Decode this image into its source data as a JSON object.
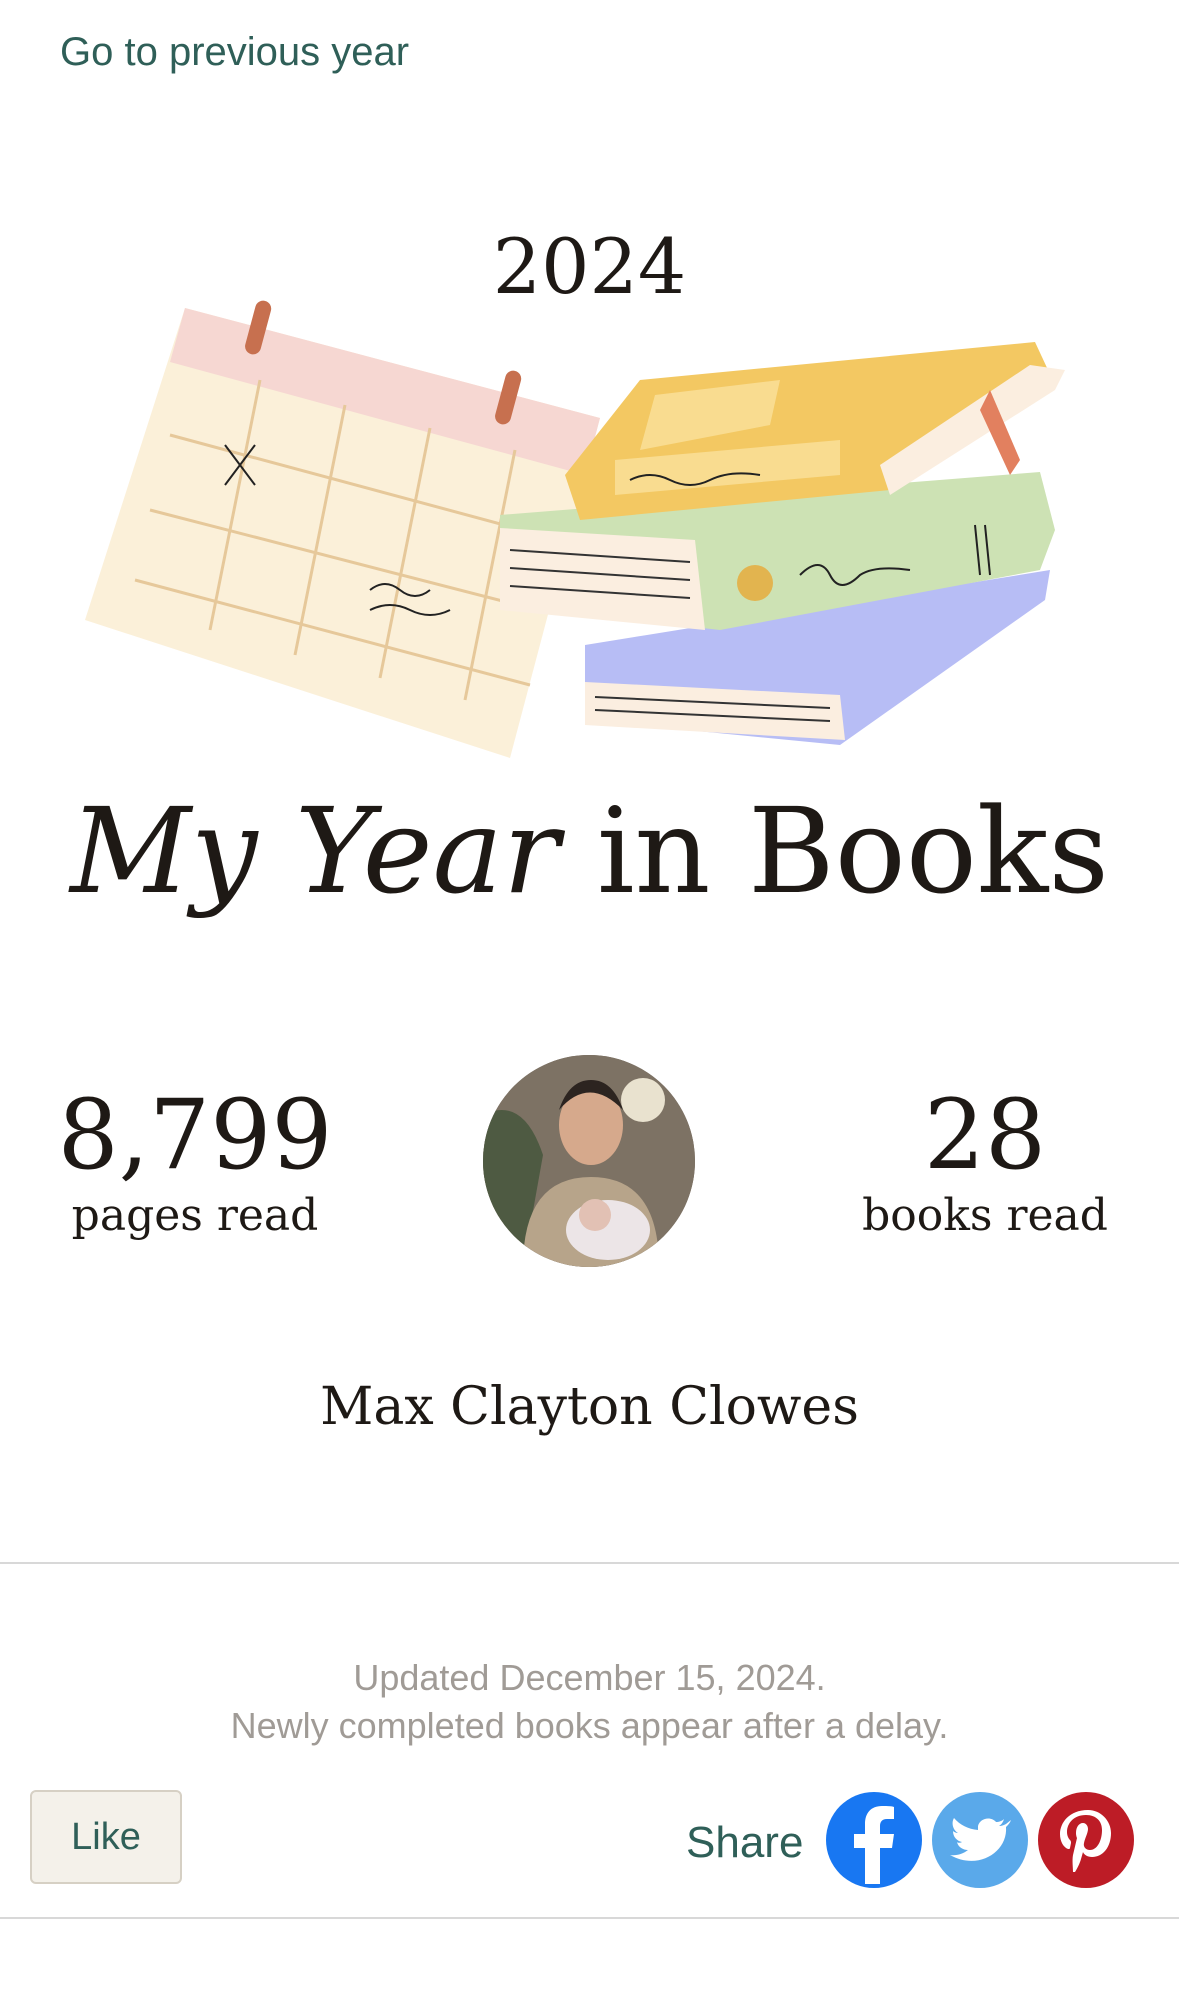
{
  "nav": {
    "previous_year_link": "Go to previous year"
  },
  "header": {
    "year": "2024"
  },
  "title": {
    "part1": "My Year",
    "part2": "in Books"
  },
  "stats": {
    "pages": {
      "value": "8,799",
      "label": "pages read"
    },
    "books": {
      "value": "28",
      "label": "books read"
    }
  },
  "user": {
    "name": "Max Clayton Clowes"
  },
  "footer": {
    "updated_text": "Updated December 15, 2024.",
    "delay_note": "Newly completed books appear after a delay.",
    "like_label": "Like",
    "share_label": "Share",
    "social": [
      "facebook-icon",
      "twitter-icon",
      "pinterest-icon"
    ]
  },
  "colors": {
    "link": "#2f5f58",
    "facebook": "#1877f2",
    "twitter": "#5aa9ea",
    "pinterest": "#bd1c26"
  }
}
